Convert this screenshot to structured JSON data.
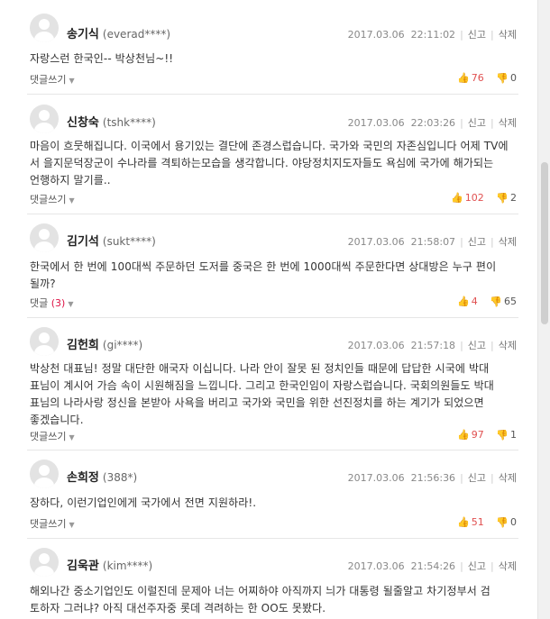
{
  "actions": {
    "report": "신고",
    "delete": "삭제"
  },
  "comments": [
    {
      "name": "송기식",
      "id": "(everad****)",
      "date": "2017.03.06",
      "time": "22:11:02",
      "lines": [
        "자랑스런 한국인-- 박상천님~!!"
      ],
      "reply_label": "댓글쓰기",
      "reply_count": "",
      "up": "76",
      "down": "0"
    },
    {
      "name": "신창숙",
      "id": "(tshk****)",
      "date": "2017.03.06",
      "time": "22:03:26",
      "lines": [
        "마음이 흐뭇해집니다. 이국에서 용기있는 결단에 존경스럽습니다. 국가와 국민의 자존심입니다 어제 TV에",
        "서 을지문덕장군이 수나라를 격퇴하는모습을 생각합니다. 야당정치지도자들도 욕심에 국가에 해가되는",
        "언행하지 말기를.."
      ],
      "reply_label": "댓글쓰기",
      "reply_count": "",
      "up": "102",
      "down": "2"
    },
    {
      "name": "김기석",
      "id": "(sukt****)",
      "date": "2017.03.06",
      "time": "21:58:07",
      "lines": [
        "한국에서 한 번에 100대씩 주문하던 도저를 중국은 한 번에 1000대씩 주문한다면 상대방은 누구 편이",
        "될까?"
      ],
      "reply_label": "댓글",
      "reply_count": "(3)",
      "up": "4",
      "down": "65"
    },
    {
      "name": "김헌희",
      "id": "(gi****)",
      "date": "2017.03.06",
      "time": "21:57:18",
      "lines": [
        "박상천 대표님! 정말 대단한 애국자 이십니다. 나라 안이 잘못 된 정치인들 때문에 답답한 시국에 박대",
        "표님이 계시어 가슴 속이 시원해짐을 느낍니다. 그리고 한국인임이 자랑스럽습니다. 국회의원들도 박대",
        "표님의 나라사랑 정신을 본받아 사욕을 버리고 국가와 국민을 위한 선진정치를 하는 계기가 되었으면",
        "좋겠습니다."
      ],
      "reply_label": "댓글쓰기",
      "reply_count": "",
      "up": "97",
      "down": "1"
    },
    {
      "name": "손희정",
      "id": "(388*)",
      "date": "2017.03.06",
      "time": "21:56:36",
      "lines": [
        "장하다, 이런기업인에게 국가에서 전면 지원하라!."
      ],
      "reply_label": "댓글쓰기",
      "reply_count": "",
      "up": "51",
      "down": "0"
    },
    {
      "name": "김욱관",
      "id": "(kim****)",
      "date": "2017.03.06",
      "time": "21:54:26",
      "lines": [
        "해외나간 중소기업인도 이럴진데 문제아 너는 어찌하야 아직까지 늬가 대통령 될줄알고 차기정부서 검",
        "토하자 그러냐? 아직 대선주자중 롯데 격려하는 한 OO도 못봤다."
      ],
      "reply_label": "",
      "reply_count": "",
      "up": "",
      "down": ""
    }
  ]
}
